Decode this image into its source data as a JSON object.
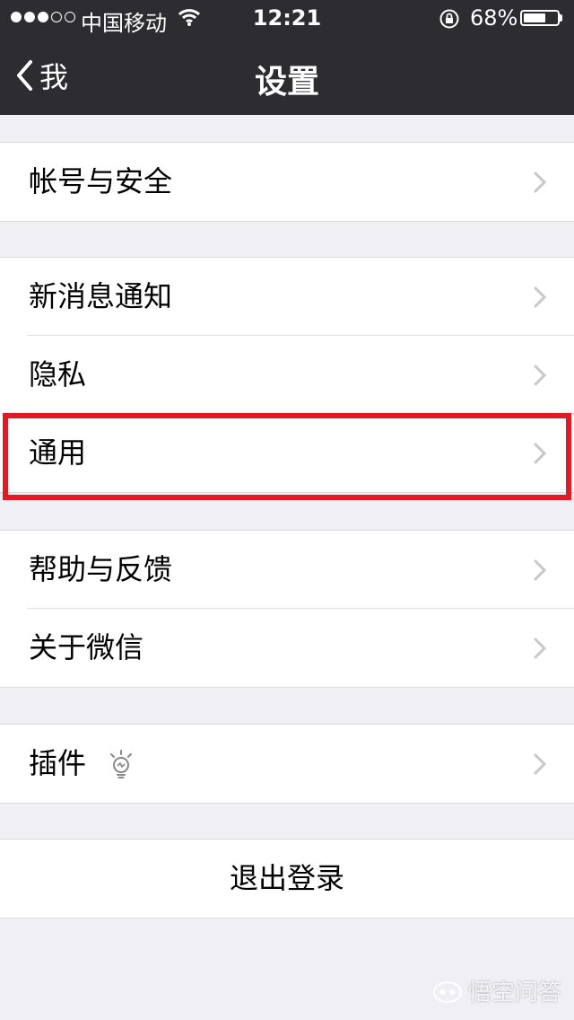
{
  "status_bar": {
    "carrier": "中国移动",
    "time": "12:21",
    "battery_percent": "68%",
    "signal_strength": 3,
    "signal_max": 5,
    "battery_level": 0.68
  },
  "nav": {
    "back_label": "我",
    "title": "设置"
  },
  "groups": [
    {
      "items": [
        {
          "label": "帐号与安全"
        }
      ]
    },
    {
      "items": [
        {
          "label": "新消息通知"
        },
        {
          "label": "隐私"
        },
        {
          "label": "通用",
          "highlighted": true
        }
      ]
    },
    {
      "items": [
        {
          "label": "帮助与反馈"
        },
        {
          "label": "关于微信"
        }
      ]
    },
    {
      "items": [
        {
          "label": "插件",
          "icon": "lightbulb-icon"
        }
      ]
    }
  ],
  "logout_label": "退出登录",
  "watermark": {
    "text": "悟空问答",
    "icon": "wukong-logo-icon"
  },
  "colors": {
    "topbar": "#2d2d31",
    "background": "#efeff4",
    "highlight": "#e01b24",
    "chevron": "#c7c7cc"
  }
}
